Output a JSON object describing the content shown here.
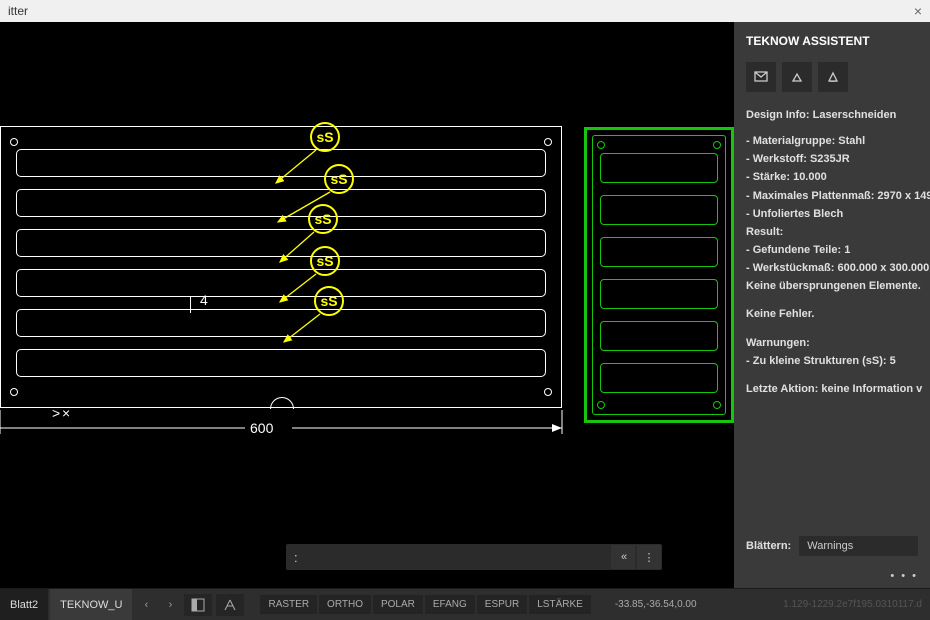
{
  "window": {
    "title_fragment": "itter",
    "close_glyph": "×"
  },
  "drawing": {
    "ss_label": "sS",
    "dim_label_4": "4",
    "dim_bottom": "600"
  },
  "command": {
    "prompt": ":"
  },
  "assistant": {
    "title": "TEKNOW ASSISTENT",
    "design_info_heading": "Design Info: Laserschneiden",
    "lines": {
      "material_group": "- Materialgruppe: Stahl",
      "material": "- Werkstoff: S235JR",
      "thickness": "- Stärke: 10.000",
      "max_plate": "- Maximales Plattenmaß: 2970 x 149",
      "unlaminated": "- Unfoliertes Blech",
      "result_heading": "Result:",
      "found_parts": "- Gefundene Teile: 1",
      "piece_dim": "- Werkstückmaß: 600.000 x 300.000",
      "skipped_none": "Keine übersprungenen Elemente.",
      "no_errors": "Keine Fehler.",
      "warnings_heading": "Warnungen:",
      "warn1": "- Zu kleine Strukturen (sS): 5",
      "last_action": "Letzte Aktion: keine Information v"
    },
    "browse_label": "Blättern:",
    "browse_value": "Warnings"
  },
  "status": {
    "tabs": {
      "t0": "Blatt2",
      "t1": "TEKNOW_U"
    },
    "toggles": {
      "raster": "RASTER",
      "ortho": "ORTHO",
      "polar": "POLAR",
      "efang": "EFANG",
      "espur": "ESPUR",
      "lstaerke": "LSTÄRKE"
    },
    "coords": "-33.85,-36.54,0.00",
    "build": "1.129-1229.2e7f195.0310117.d"
  }
}
